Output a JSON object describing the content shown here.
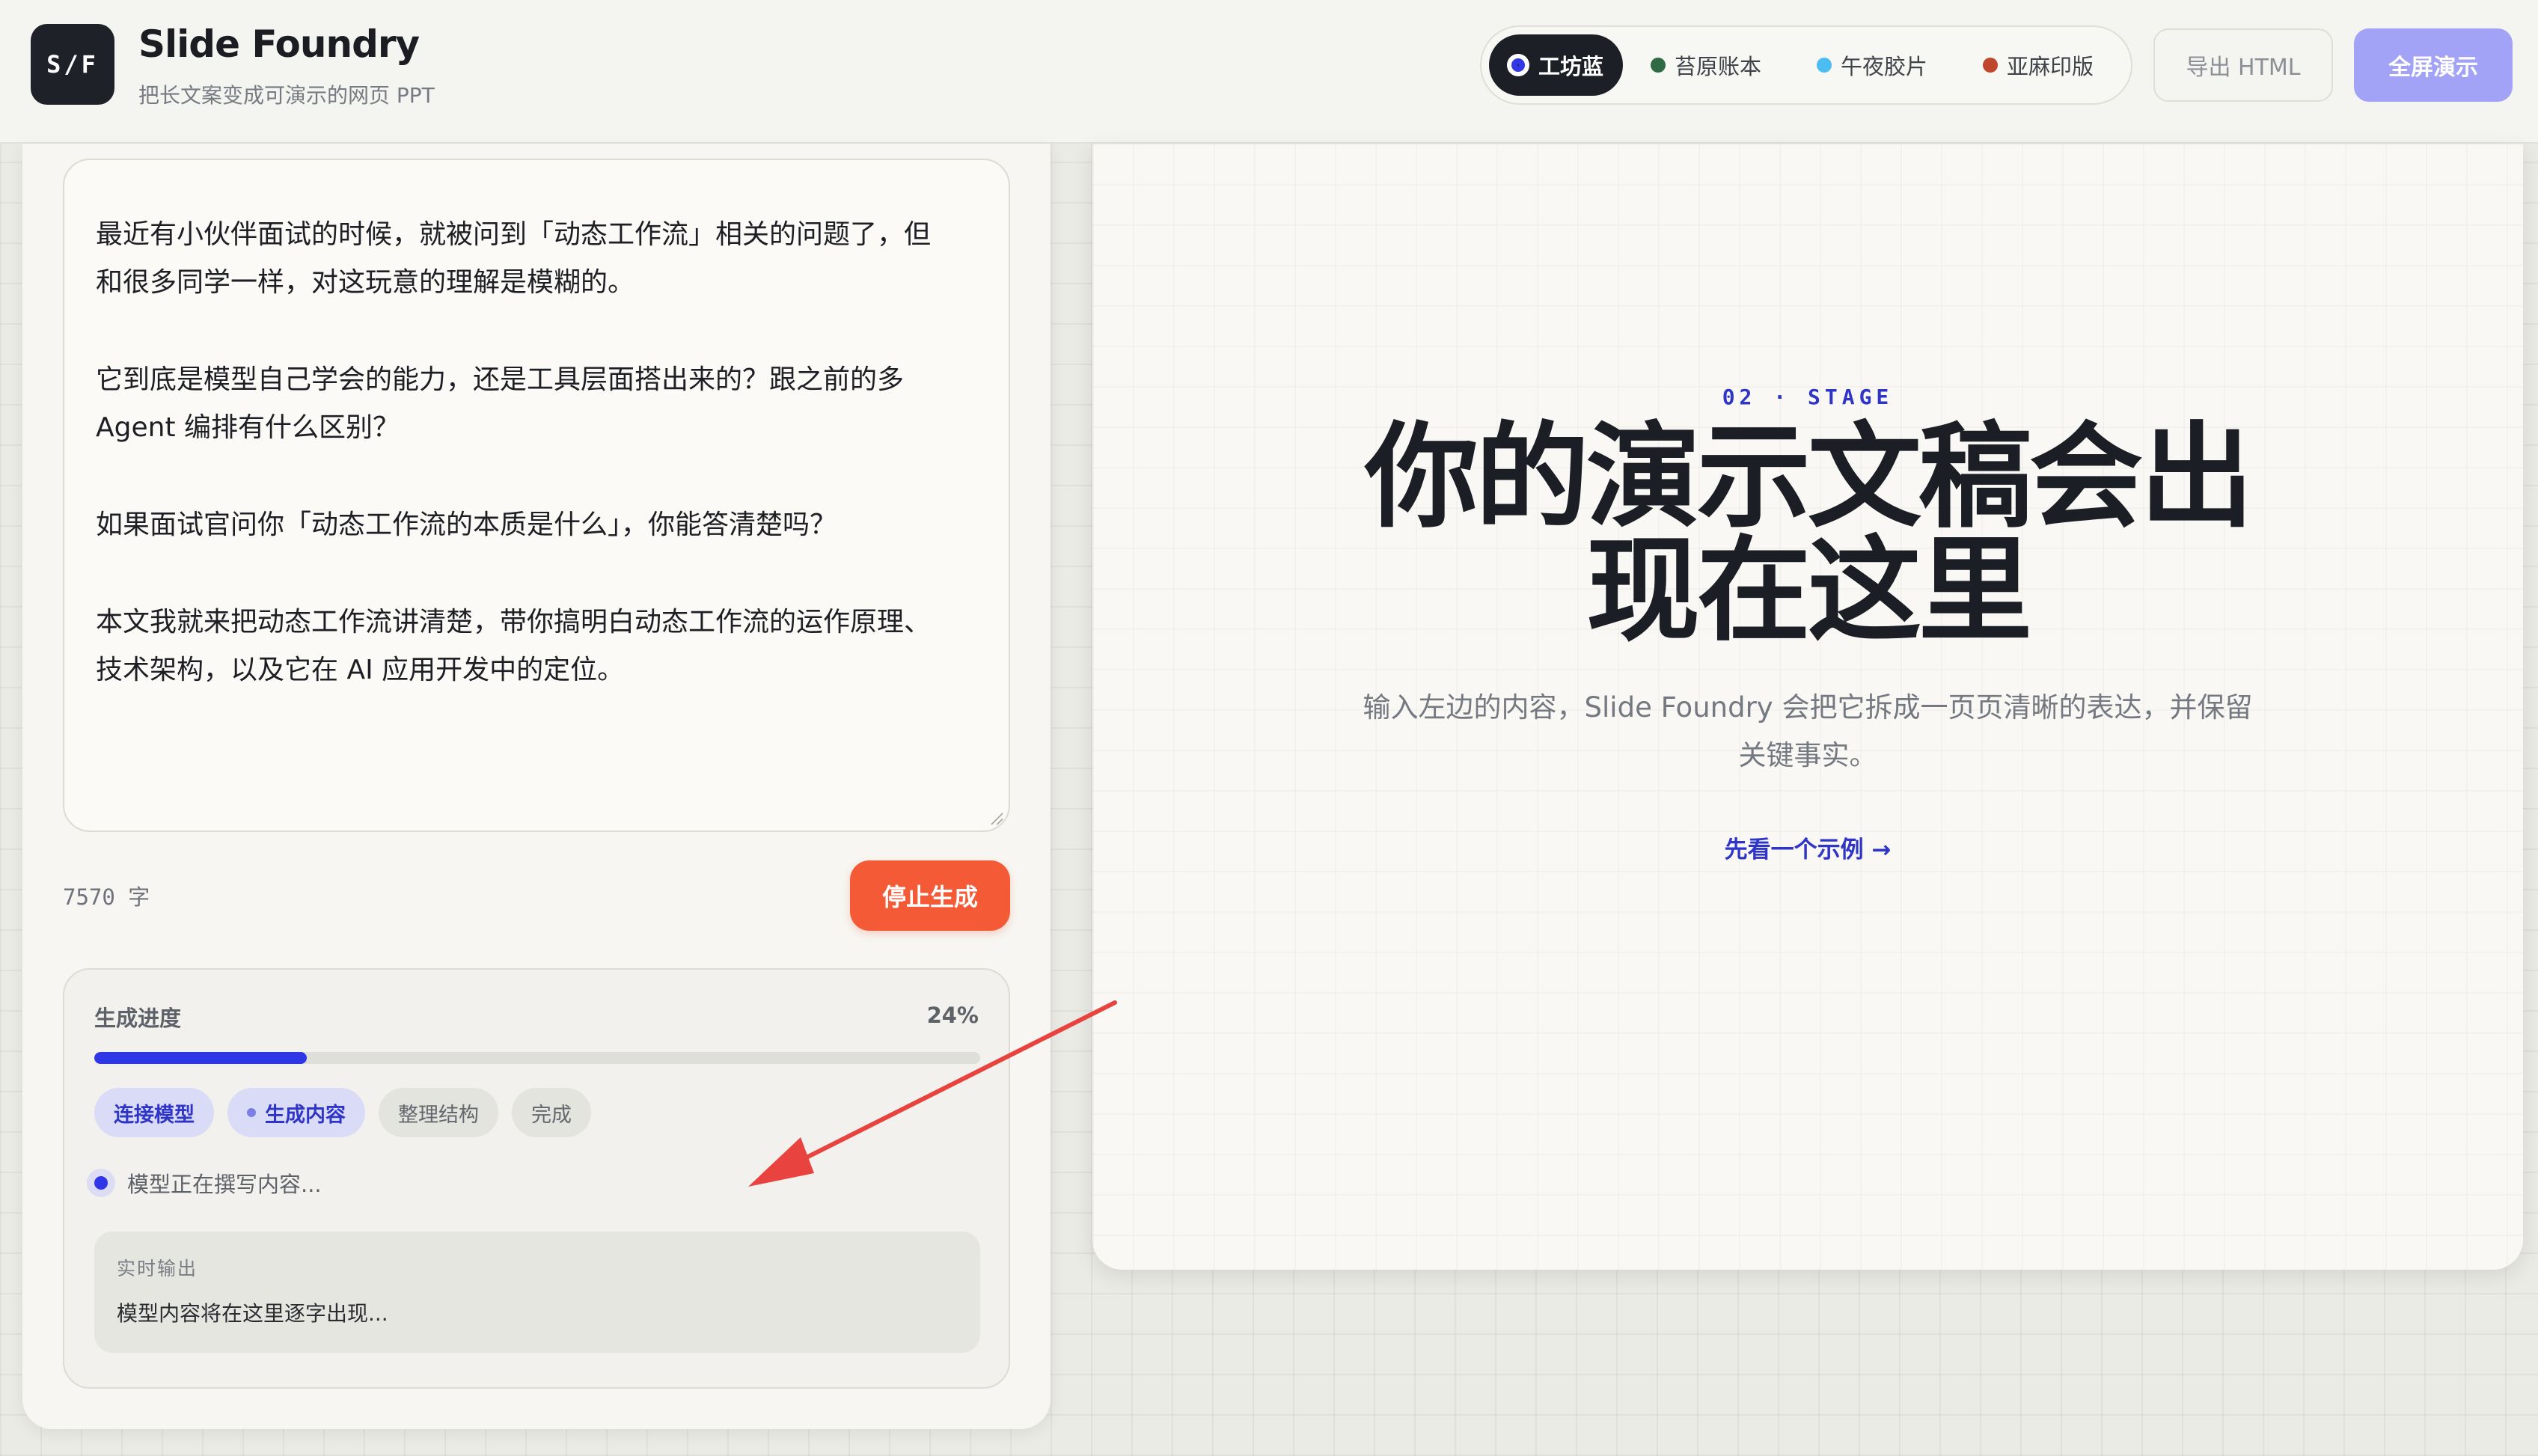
{
  "app": {
    "logo_text": "S/F",
    "title": "Slide Foundry",
    "subtitle": "把长文案变成可演示的网页 PPT"
  },
  "themes": [
    {
      "label": "工坊蓝",
      "color": "#3237e8",
      "active": true
    },
    {
      "label": "苔原账本",
      "color": "#2f6a45",
      "active": false
    },
    {
      "label": "午夜胶片",
      "color": "#4bbdf0",
      "active": false
    },
    {
      "label": "亚麻印版",
      "color": "#c0472c",
      "active": false
    }
  ],
  "toolbar": {
    "export_label": "导出 HTML",
    "present_label": "全屏演示"
  },
  "editor": {
    "paragraphs": [
      [
        "最近有小伙伴面试的时候，就被问到「动态工作流」相关的问题了，但",
        "和很多同学一样，对这玩意的理解是模糊的。"
      ],
      [
        "它到底是模型自己学会的能力，还是工具层面搭出来的？跟之前的多",
        "Agent 编排有什么区别？"
      ],
      [
        "如果面试官问你「动态工作流的本质是什么」，你能答清楚吗？"
      ],
      [
        "本文我就来把动态工作流讲清楚，带你搞明白动态工作流的运作原理、",
        "技术架构，以及它在 AI 应用开发中的定位。"
      ]
    ],
    "char_count": "7570 字",
    "stop_label": "停止生成"
  },
  "progress": {
    "label": "生成进度",
    "percent_text": "24%",
    "percent": 0.24,
    "steps": [
      {
        "label": "连接模型",
        "state": "done"
      },
      {
        "label": "生成内容",
        "state": "current"
      },
      {
        "label": "整理结构",
        "state": "pending"
      },
      {
        "label": "完成",
        "state": "pending"
      }
    ],
    "status": "模型正在撰写内容...",
    "live_title": "实时输出",
    "live_text": "模型内容将在这里逐字出现..."
  },
  "stage": {
    "eyebrow": "02 · STAGE",
    "title": "你的演示文稿会出现在这里",
    "description": "输入左边的内容，Slide Foundry 会把它拆成一页页清晰的表达，并保留关键事实。",
    "link": "先看一个示例 →"
  },
  "colors": {
    "accent": "#2f35c7",
    "stop": "#f55a36",
    "annotation_arrow": "#e8433f"
  }
}
